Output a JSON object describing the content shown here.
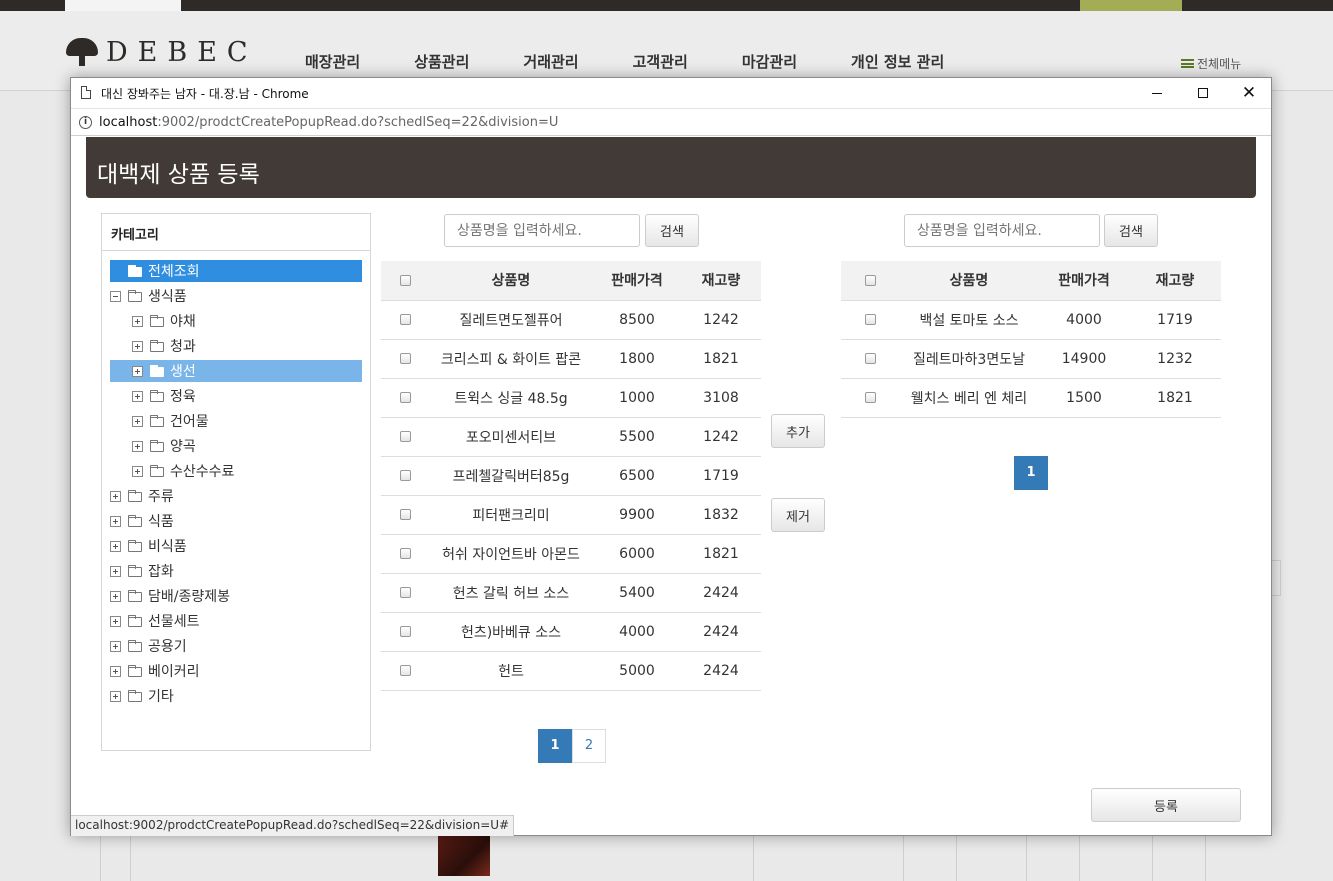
{
  "site": {
    "logo_text": "DEBEC",
    "nav": [
      "매장관리",
      "상품관리",
      "거래관리",
      "고객관리",
      "마감관리",
      "개인 정보 관리"
    ],
    "all_menu": "전체메뉴"
  },
  "window": {
    "title": "대신 장봐주는 남자 - 대.장.남 - Chrome",
    "url_host": "localhost",
    "url_path": ":9002/prodctCreatePopupRead.do?schedlSeq=22&division=U",
    "status_url": "localhost:9002/prodctCreatePopupRead.do?schedlSeq=22&division=U#"
  },
  "page": {
    "title": "대백제 상품 등록",
    "category_header": "카테고리"
  },
  "tree": [
    {
      "label": "전체조회",
      "level": 0,
      "toggle": "none",
      "state": "selected"
    },
    {
      "label": "생식품",
      "level": 0,
      "toggle": "minus",
      "state": ""
    },
    {
      "label": "야채",
      "level": 1,
      "toggle": "plus",
      "state": ""
    },
    {
      "label": "청과",
      "level": 1,
      "toggle": "plus",
      "state": ""
    },
    {
      "label": "생선",
      "level": 1,
      "toggle": "plus",
      "state": "hovered"
    },
    {
      "label": "정육",
      "level": 1,
      "toggle": "plus",
      "state": ""
    },
    {
      "label": "건어물",
      "level": 1,
      "toggle": "plus",
      "state": ""
    },
    {
      "label": "양곡",
      "level": 1,
      "toggle": "plus",
      "state": ""
    },
    {
      "label": "수산수수료",
      "level": 1,
      "toggle": "plus",
      "state": ""
    },
    {
      "label": "주류",
      "level": 0,
      "toggle": "plus",
      "state": ""
    },
    {
      "label": "식품",
      "level": 0,
      "toggle": "plus",
      "state": ""
    },
    {
      "label": "비식품",
      "level": 0,
      "toggle": "plus",
      "state": ""
    },
    {
      "label": "잡화",
      "level": 0,
      "toggle": "plus",
      "state": ""
    },
    {
      "label": "담배/종량제봉",
      "level": 0,
      "toggle": "plus",
      "state": ""
    },
    {
      "label": "선물세트",
      "level": 0,
      "toggle": "plus",
      "state": ""
    },
    {
      "label": "공용기",
      "level": 0,
      "toggle": "plus",
      "state": ""
    },
    {
      "label": "베이커리",
      "level": 0,
      "toggle": "plus",
      "state": ""
    },
    {
      "label": "기타",
      "level": 0,
      "toggle": "plus",
      "state": ""
    }
  ],
  "left_search": {
    "placeholder": "상품명을 입력하세요.",
    "button": "검색"
  },
  "right_search": {
    "placeholder": "상품명을 입력하세요.",
    "button": "검색"
  },
  "columns": [
    "상품명",
    "판매가격",
    "재고량"
  ],
  "left_products": [
    {
      "name": "질레트면도젤퓨어",
      "price": "8500",
      "stock": "1242"
    },
    {
      "name": "크리스피 & 화이트 팝콘",
      "price": "1800",
      "stock": "1821"
    },
    {
      "name": "트윅스 싱글 48.5g",
      "price": "1000",
      "stock": "3108"
    },
    {
      "name": "포오미센서티브",
      "price": "5500",
      "stock": "1242"
    },
    {
      "name": "프레첼갈릭버터85g",
      "price": "6500",
      "stock": "1719"
    },
    {
      "name": "피터팬크리미",
      "price": "9900",
      "stock": "1832"
    },
    {
      "name": "허쉬 자이언트바 아몬드",
      "price": "6000",
      "stock": "1821"
    },
    {
      "name": "헌츠 갈릭 허브 소스",
      "price": "5400",
      "stock": "2424"
    },
    {
      "name": "헌츠)바베큐 소스",
      "price": "4000",
      "stock": "2424"
    },
    {
      "name": "헌트",
      "price": "5000",
      "stock": "2424"
    }
  ],
  "right_products": [
    {
      "name": "백설 토마토 소스",
      "price": "4000",
      "stock": "1719"
    },
    {
      "name": "질레트마하3면도날",
      "price": "14900",
      "stock": "1232"
    },
    {
      "name": "웰치스 베리 엔 체리",
      "price": "1500",
      "stock": "1821"
    }
  ],
  "left_pages": [
    "1",
    "2"
  ],
  "right_pages": [
    "1"
  ],
  "buttons": {
    "add": "추가",
    "remove": "제거",
    "register": "등록"
  },
  "colors": {
    "header_bg": "#413a36",
    "selected": "#2f8ee0",
    "hover": "#7ab5ea",
    "pager_active": "#337ab7"
  }
}
